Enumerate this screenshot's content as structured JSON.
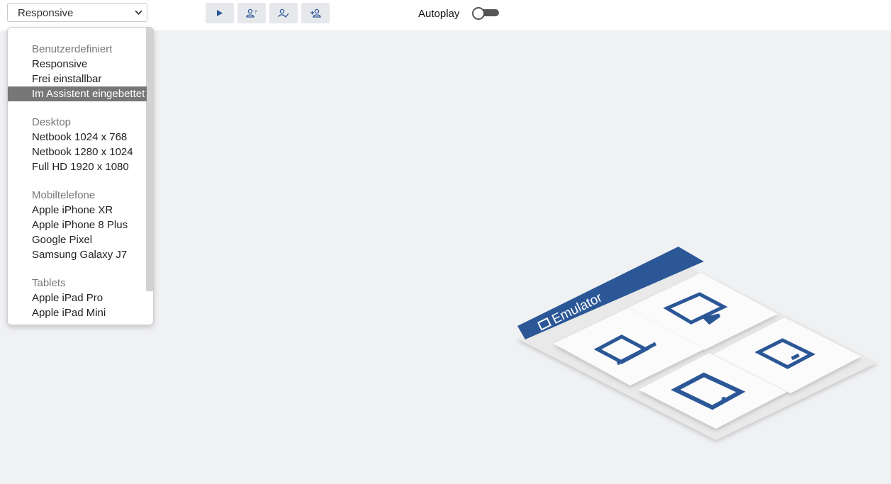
{
  "toolbar": {
    "select_value": "Responsive",
    "autoplay_label": "Autoplay",
    "autoplay_on": false,
    "buttons": [
      {
        "name": "play-button",
        "icon": "play-icon"
      },
      {
        "name": "user-question-button",
        "icon": "user-question-icon"
      },
      {
        "name": "user-check-button",
        "icon": "user-check-icon"
      },
      {
        "name": "user-add-button",
        "icon": "user-add-icon"
      }
    ],
    "accent": "#2b5797"
  },
  "dropdown": {
    "groups": [
      {
        "label": "Benutzerdefiniert",
        "options": [
          "Responsive",
          "Frei einstallbar",
          "Im Assistent eingebettet"
        ]
      },
      {
        "label": "Desktop",
        "options": [
          "Netbook 1024 x 768",
          "Netbook 1280 x 1024",
          "Full HD 1920 x 1080"
        ]
      },
      {
        "label": "Mobiltelefone",
        "options": [
          "Apple iPhone XR",
          "Apple iPhone 8 Plus",
          "Google Pixel",
          "Samsung Galaxy J7"
        ]
      },
      {
        "label": "Tablets",
        "options": [
          "Apple iPad Pro",
          "Apple iPad Mini"
        ]
      }
    ],
    "selected": "Im Assistent eingebettet"
  },
  "emulator": {
    "banner_text": "Emulator",
    "tiles": [
      "monitor-icon",
      "laptop-icon",
      "phone-icon",
      "tablet-icon"
    ],
    "brand_color": "#2b5797"
  }
}
